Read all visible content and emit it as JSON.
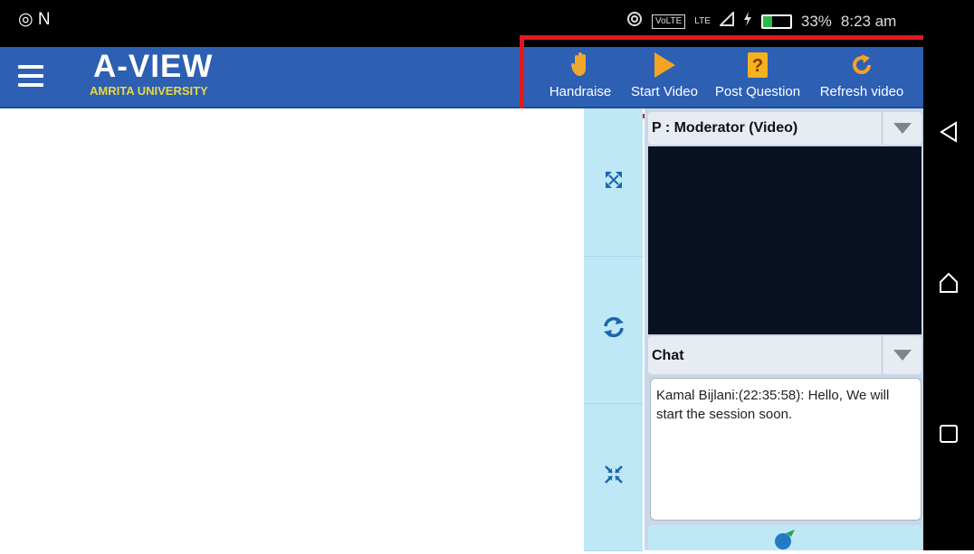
{
  "status_bar": {
    "left_text": "◎ N",
    "right_icons": [
      "hotspot-icon",
      "volte-icon",
      "signal-icon",
      "charging-icon",
      "battery-icon"
    ],
    "volte": "VoLTE",
    "network": "LTE",
    "battery_level": 0.33,
    "battery_percent": "33%",
    "time": "8:23 am"
  },
  "app_bar": {
    "title": "A-VIEW",
    "subtitle": "AMRITA UNIVERSITY",
    "background": "#2d5fb3",
    "actions": [
      {
        "label": "Handraise",
        "icon": "hand-raise-icon"
      },
      {
        "label": "Start Video",
        "icon": "play-icon"
      },
      {
        "label": "Post Question",
        "icon": "question-icon"
      },
      {
        "label": "Refresh video",
        "icon": "refresh-icon"
      }
    ]
  },
  "highlight_color": "#e2181f",
  "side_controls": [
    {
      "icon": "expand-icon"
    },
    {
      "icon": "swap-icon"
    },
    {
      "icon": "collapse-icon"
    }
  ],
  "video_panel": {
    "selected": "P : Moderator (Video)"
  },
  "chat_panel": {
    "selected": "Chat",
    "messages": [
      "Kamal Bijlani:(22:35:58): Hello, We will start the session soon."
    ]
  },
  "send_button": {
    "icon": "send-icon"
  },
  "nav_bar": {
    "buttons": [
      "back-icon",
      "home-icon",
      "recents-icon"
    ]
  }
}
